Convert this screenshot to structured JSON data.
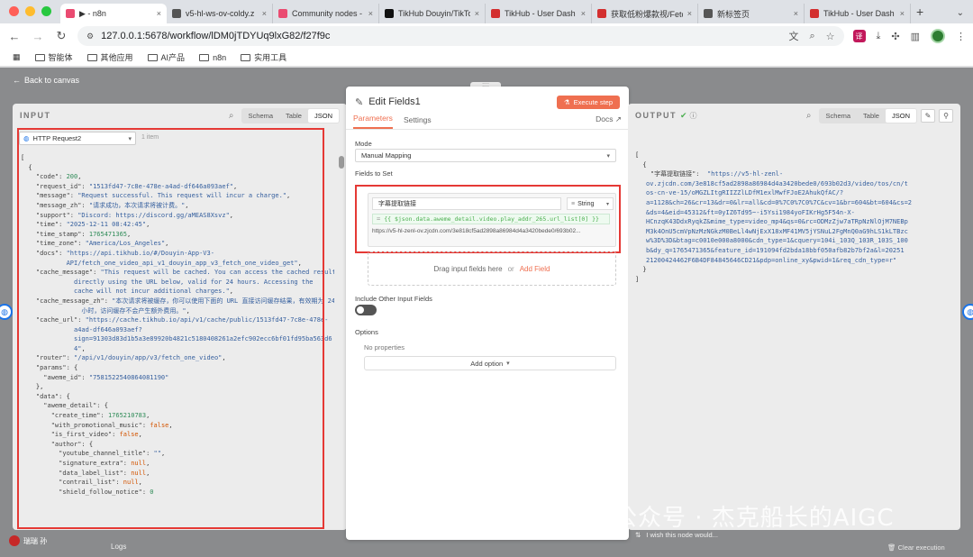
{
  "browser": {
    "tabs": [
      {
        "label": "▶ - n8n",
        "color": "#ea4b71",
        "active": true
      },
      {
        "label": "v5-hl-ws-ov-coldy.z",
        "color": "#555555",
        "active": false
      },
      {
        "label": "Community nodes -",
        "color": "#ea4b71",
        "active": false
      },
      {
        "label": "TikHub Douyin/TikTo",
        "color": "#111111",
        "active": false
      },
      {
        "label": "TikHub - User Dash",
        "color": "#d32f2f",
        "active": false
      },
      {
        "label": "获取低粉爆款视/Fetch",
        "color": "#d32f2f",
        "active": false
      },
      {
        "label": "新标签页",
        "color": "#555555",
        "active": false
      },
      {
        "label": "TikHub - User Dash",
        "color": "#d32f2f",
        "active": false
      }
    ],
    "url": "127.0.0.1:5678/workflow/lDM0jTDYUq9lxG82/f27f9c",
    "bookmarks": [
      "智能体",
      "其他应用",
      "AI产品",
      "n8n",
      "实用工具"
    ]
  },
  "canvas": {
    "back_label": "Back to canvas"
  },
  "input_panel": {
    "title": "INPUT",
    "view_tabs": [
      "Schema",
      "Table",
      "JSON"
    ],
    "active_view": "JSON",
    "node_name": "HTTP Request2",
    "item_count": "1 item"
  },
  "edit_panel": {
    "node_title": "Edit Fields1",
    "execute_label": "Execute step",
    "tabs": [
      "Parameters",
      "Settings"
    ],
    "docs_label": "Docs",
    "mode_label": "Mode",
    "mode_value": "Manual Mapping",
    "fields_label": "Fields to Set",
    "field_name": "字幕提取链接",
    "field_type": "String",
    "field_expression": "{{ $json.data.aweme_detail.video.play_addr_265.url_list[0] }}",
    "field_preview": "https://v5-hl-zenl-ov.zjcdn.com/3e818cf5ad2898a86984d4a3420bede0/693b02...",
    "drop_text": "Drag input fields here",
    "drop_or": "or",
    "add_field_label": "Add Field",
    "include_other_label": "Include Other Input Fields",
    "options_label": "Options",
    "no_properties": "No properties",
    "add_option_label": "Add option"
  },
  "output_panel": {
    "title": "OUTPUT",
    "view_tabs": [
      "Schema",
      "Table",
      "JSON"
    ],
    "active_view": "JSON",
    "key": "\"字幕提取链接\":",
    "value_lines": [
      "\"https://v5-hl-zenl-",
      "ov.zjcdn.com/3e818cf5ad2898a86984d4a3420bede0/693b02d3/video/tos/cn/t",
      "os-cn-ve-15/oMGZLItgRIIZZlLDfM1exlMwfFJoE2AhukQfAC/?",
      "a=1128&ch=26&cr=13&dr=0&lr=all&cd=0%7C0%7C0%7C&cv=1&br=604&bt=604&cs=2",
      "&ds=4&eid=45312&ft=0yIZ6Td95~-i5Ysi1984yoFIKrHg5F54n-X-",
      "HCnzqK43DdxRyqkZ&mime_type=video_mp4&qs=0&rc=ODMzZjw7aTRpNzNlOjM7NEBp",
      "M3k4OnU5cmVpNzMzNGkzM0BeLl4wNjExX18xMF41MV5jYSNuL2FgMnQ0aG9hLS1kLTBzc",
      "w%3D%3D&btag=c0010e000a8000&cdn_type=1&cquery=104i_103Q_103R_103S_100",
      "b&dy_q=1765471365&feature_id=191094fd2bda18bbf050afb82b7bf2a&l=20251",
      "21200424462F6B4DF84845646CD21&pdp=online_xy&pwid=1&req_cdn_type=r\""
    ]
  },
  "input_json_lines": [
    [
      [
        "p",
        "["
      ]
    ],
    [
      [
        "p",
        "  {"
      ]
    ],
    [
      [
        "k",
        "    \"code\": "
      ],
      [
        "n",
        "200"
      ],
      [
        "p",
        ","
      ]
    ],
    [
      [
        "k",
        "    \"request_id\": "
      ],
      [
        "s",
        "\"1513fd47-7c8e-478e-a4ad-df646a093aef\""
      ],
      [
        "p",
        ","
      ]
    ],
    [
      [
        "k",
        "    \"message\": "
      ],
      [
        "s",
        "\"Request successful. This request will incur a charge.\""
      ],
      [
        "p",
        ","
      ]
    ],
    [
      [
        "k",
        "    \"message_zh\": "
      ],
      [
        "s",
        "\"请求成功，本次请求将被计费。\""
      ],
      [
        "p",
        ","
      ]
    ],
    [
      [
        "k",
        "    \"support\": "
      ],
      [
        "s",
        "\"Discord: https://discord.gg/aMEAS8Xsvz\""
      ],
      [
        "p",
        ","
      ]
    ],
    [
      [
        "k",
        "    \"time\": "
      ],
      [
        "s",
        "\"2025-12-11 08:42:45\""
      ],
      [
        "p",
        ","
      ]
    ],
    [
      [
        "k",
        "    \"time_stamp\": "
      ],
      [
        "n",
        "1765471365"
      ],
      [
        "p",
        ","
      ]
    ],
    [
      [
        "k",
        "    \"time_zone\": "
      ],
      [
        "s",
        "\"America/Los_Angeles\""
      ],
      [
        "p",
        ","
      ]
    ],
    [
      [
        "k",
        "    \"docs\": "
      ],
      [
        "s",
        "\"https://api.tikhub.io/#/Douyin-App-V3-"
      ]
    ],
    [
      [
        "s",
        "            API/fetch_one_video_api_v1_douyin_app_v3_fetch_one_video_get\""
      ],
      [
        "p",
        ","
      ]
    ],
    [
      [
        "k",
        "    \"cache_message\": "
      ],
      [
        "s",
        "\"This request will be cached. You can access the cached result"
      ]
    ],
    [
      [
        "s",
        "              directly using the URL below, valid for 24 hours. Accessing the"
      ]
    ],
    [
      [
        "s",
        "              cache will not incur additional charges.\""
      ],
      [
        "p",
        ","
      ]
    ],
    [
      [
        "k",
        "    \"cache_message_zh\": "
      ],
      [
        "s",
        "\"本次请求将被缓存，你可以使用下面的 URL 直接访问缓存结果，有效期为 24"
      ]
    ],
    [
      [
        "s",
        "                小时，访问缓存不会产生额外费用。\""
      ],
      [
        "p",
        ","
      ]
    ],
    [
      [
        "k",
        "    \"cache_url\": "
      ],
      [
        "s",
        "\"https://cache.tikhub.io/api/v1/cache/public/1513fd47-7c8e-478e-"
      ]
    ],
    [
      [
        "s",
        "              a4ad-df646a093aef?"
      ]
    ],
    [
      [
        "s",
        "              sign=91303d83d1b5a3e89920b4821c5180408261a2efc902ecc6bf01fd95ba563d6"
      ]
    ],
    [
      [
        "s",
        "              4\""
      ],
      [
        "p",
        ","
      ]
    ],
    [
      [
        "k",
        "    \"router\": "
      ],
      [
        "s",
        "\"/api/v1/douyin/app/v3/fetch_one_video\""
      ],
      [
        "p",
        ","
      ]
    ],
    [
      [
        "k",
        "    \"params\": "
      ],
      [
        "p",
        "{"
      ]
    ],
    [
      [
        "k",
        "      \"aweme_id\": "
      ],
      [
        "s",
        "\"7581522540864081190\""
      ]
    ],
    [
      [
        "p",
        "    },"
      ]
    ],
    [
      [
        "k",
        "    \"data\": "
      ],
      [
        "p",
        "{"
      ]
    ],
    [
      [
        "k",
        "      \"aweme_detail\": "
      ],
      [
        "p",
        "{"
      ]
    ],
    [
      [
        "k",
        "        \"create_time\": "
      ],
      [
        "n",
        "1765210783"
      ],
      [
        "p",
        ","
      ]
    ],
    [
      [
        "k",
        "        \"with_promotional_music\": "
      ],
      [
        "b",
        "false"
      ],
      [
        "p",
        ","
      ]
    ],
    [
      [
        "k",
        "        \"is_first_video\": "
      ],
      [
        "b",
        "false"
      ],
      [
        "p",
        ","
      ]
    ],
    [
      [
        "k",
        "        \"author\": "
      ],
      [
        "p",
        "{"
      ]
    ],
    [
      [
        "k",
        "          \"youtube_channel_title\": "
      ],
      [
        "s",
        "\"\""
      ],
      [
        "p",
        ","
      ]
    ],
    [
      [
        "k",
        "          \"signature_extra\": "
      ],
      [
        "b",
        "null"
      ],
      [
        "p",
        ","
      ]
    ],
    [
      [
        "k",
        "          \"data_label_list\": "
      ],
      [
        "b",
        "null"
      ],
      [
        "p",
        ","
      ]
    ],
    [
      [
        "k",
        "          \"contrail_list\": "
      ],
      [
        "b",
        "null"
      ],
      [
        "p",
        ","
      ]
    ],
    [
      [
        "k",
        "          \"shield_follow_notice\": "
      ],
      [
        "n",
        "0"
      ]
    ]
  ],
  "footer": {
    "user_name": "瑞瑞 孙",
    "logs_label": "Logs",
    "hint_text": "I wish this node would...",
    "clear_label": "Clear execution"
  },
  "watermark_text": "公众号 · 杰克船长的AIGC",
  "colors": {
    "accent": "#ef6f50",
    "highlight_border": "#e53935",
    "success": "#4caf50"
  }
}
